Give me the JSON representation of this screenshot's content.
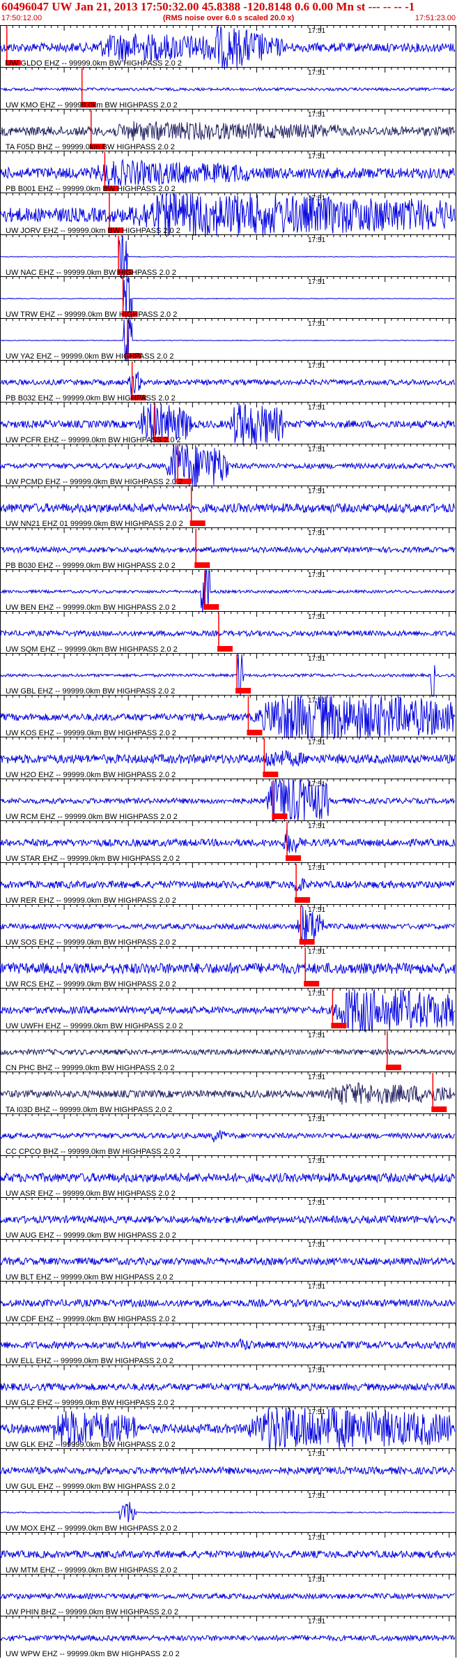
{
  "header": {
    "title": "60496047 UW Jan 21, 2013 17:50:32.00   45.8388 -120.8148  0.6 0.00 Mn st --- -- --  -1",
    "rms_note": "(RMS noise over 6.0 s scaled 20.0 x)",
    "time_start": "17:50:12.00",
    "time_end": "17:51:23.00"
  },
  "colors": {
    "trace": "#0000e0",
    "pick": "#ff0000",
    "axis": "#000000",
    "label": "#000000",
    "dark_trace": "#202060"
  },
  "minute_label": "17:51",
  "traces": [
    {
      "label": "UW GLDO EHZ -- 99999.0km BW  HIGHPASS  2.0  2",
      "amp": 0.25,
      "pick": 0.015,
      "bursts": [
        {
          "s": 0.18,
          "e": 0.62,
          "a": 0.9
        },
        {
          "s": 0.45,
          "e": 0.58,
          "a": 1.4
        }
      ]
    },
    {
      "label": "UW KMO EHZ -- 99999.0km BW  HIGHPASS  2.0  2",
      "amp": 0.08,
      "pick": 0.18,
      "bursts": []
    },
    {
      "label": "TA F05D BHZ -- 99999.0km BW  HIGHPASS  2.0  2",
      "amp": 0.25,
      "pick": 0.2,
      "dark": true,
      "bursts": [
        {
          "s": 0.2,
          "e": 0.75,
          "a": 0.6
        }
      ]
    },
    {
      "label": "PB B001 EHZ -- 99999.0km BW  HIGHPASS  2.0  2",
      "amp": 0.3,
      "pick": 0.23,
      "bursts": [
        {
          "s": 0.18,
          "e": 0.55,
          "a": 0.8
        }
      ]
    },
    {
      "label": "UW JORV EHZ -- 99999.0km BW  HIGHPASS  2.0  2",
      "amp": 0.4,
      "pick": 0.24,
      "bursts": [
        {
          "s": 0.24,
          "e": 0.99,
          "a": 1.4
        }
      ]
    },
    {
      "label": "UW NAC EHZ -- 99999.0km BW  HIGHPASS  2.0  2",
      "amp": 0.02,
      "pick": 0.26,
      "bursts": [
        {
          "s": 0.26,
          "e": 0.28,
          "a": 3.0
        }
      ]
    },
    {
      "label": "UW TRW EHZ -- 99999.0km BW  HIGHPASS  2.0  2",
      "amp": 0.02,
      "pick": 0.27,
      "bursts": [
        {
          "s": 0.27,
          "e": 0.29,
          "a": 3.0
        }
      ]
    },
    {
      "label": "UW YA2 EHZ -- 99999.0km BW  HIGHPASS  2.0  2",
      "amp": 0.02,
      "pick": 0.28,
      "bursts": [
        {
          "s": 0.27,
          "e": 0.29,
          "a": 3.0
        }
      ]
    },
    {
      "label": "PB B032 EHZ -- 99999.0km BW  HIGHPASS  2.0  2",
      "amp": 0.15,
      "pick": 0.29,
      "bursts": [
        {
          "s": 0.28,
          "e": 0.31,
          "a": 0.8
        }
      ]
    },
    {
      "label": "UW PCFR EHZ -- 99999.0km BW  HIGHPASS  2.0  2",
      "amp": 0.2,
      "pick": 0.34,
      "bursts": [
        {
          "s": 0.3,
          "e": 0.42,
          "a": 1.4
        },
        {
          "s": 0.5,
          "e": 0.62,
          "a": 1.5
        }
      ]
    },
    {
      "label": "UW PCMD EHZ -- 99999.0km BW  HIGHPASS  2.0  2",
      "amp": 0.15,
      "pick": 0.39,
      "bursts": [
        {
          "s": 0.36,
          "e": 0.5,
          "a": 1.6
        }
      ]
    },
    {
      "label": "UW NN21 EHZ 01 99999.0km BW  HIGHPASS  2.0  2",
      "amp": 0.25,
      "pick": 0.42,
      "bursts": []
    },
    {
      "label": "PB B030 EHZ -- 99999.0km BW  HIGHPASS  2.0  2",
      "amp": 0.15,
      "pick": 0.43,
      "bursts": []
    },
    {
      "label": "UW BEN EHZ -- 99999.0km BW  HIGHPASS  2.0  2",
      "amp": 0.08,
      "pick": 0.45,
      "bursts": [
        {
          "s": 0.44,
          "e": 0.46,
          "a": 2.6
        }
      ]
    },
    {
      "label": "UW SQM EHZ -- 99999.0km BW  HIGHPASS  2.0  2",
      "amp": 0.15,
      "pick": 0.48,
      "bursts": []
    },
    {
      "label": "UW GBL EHZ -- 99999.0km BW  HIGHPASS  2.0  2",
      "amp": 0.08,
      "pick": 0.52,
      "bursts": [
        {
          "s": 0.52,
          "e": 0.535,
          "a": 2.6
        },
        {
          "s": 0.945,
          "e": 0.955,
          "a": 2.6
        }
      ]
    },
    {
      "label": "UW KOS EHZ -- 99999.0km BW  HIGHPASS  2.0  2",
      "amp": 0.2,
      "pick": 0.545,
      "bursts": [
        {
          "s": 0.545,
          "e": 0.995,
          "a": 1.6
        }
      ]
    },
    {
      "label": "UW H2O EHZ -- 99999.0km BW  HIGHPASS  2.0  2",
      "amp": 0.25,
      "pick": 0.58,
      "bursts": [
        {
          "s": 0.57,
          "e": 0.67,
          "a": 0.6
        }
      ]
    },
    {
      "label": "UW RCM EHZ -- 99999.0km BW  HIGHPASS  2.0  2",
      "amp": 0.15,
      "pick": 0.6,
      "bursts": [
        {
          "s": 0.58,
          "e": 0.72,
          "a": 1.6
        }
      ]
    },
    {
      "label": "UW STAR EHZ -- 99999.0km BW  HIGHPASS  2.0  2",
      "amp": 0.2,
      "pick": 0.63,
      "bursts": [
        {
          "s": 0.62,
          "e": 0.66,
          "a": 0.8
        }
      ]
    },
    {
      "label": "UW RER EHZ -- 99999.0km BW  HIGHPASS  2.0  2",
      "amp": 0.2,
      "pick": 0.65,
      "bursts": [
        {
          "s": 0.64,
          "e": 0.67,
          "a": 0.6
        }
      ]
    },
    {
      "label": "UW SOS EHZ -- 99999.0km BW  HIGHPASS  2.0  2",
      "amp": 0.15,
      "pick": 0.66,
      "bursts": [
        {
          "s": 0.65,
          "e": 0.71,
          "a": 1.3
        }
      ]
    },
    {
      "label": "UW RCS EHZ -- 99999.0km BW  HIGHPASS  2.0  2",
      "amp": 0.3,
      "pick": 0.67,
      "bursts": []
    },
    {
      "label": "UW UWFH EHZ -- 99999.0km BW  HIGHPASS  2.0  2",
      "amp": 0.2,
      "pick": 0.73,
      "bursts": [
        {
          "s": 0.72,
          "e": 0.995,
          "a": 1.5
        }
      ]
    },
    {
      "label": "CN PHC BHZ -- 99999.0km BW  HIGHPASS  2.0  2",
      "amp": 0.15,
      "pick": 0.85,
      "dark": true,
      "bursts": []
    },
    {
      "label": "TA I03D BHZ -- 99999.0km BW  HIGHPASS  2.0  2",
      "amp": 0.2,
      "pick": 0.95,
      "dark": true,
      "bursts": [
        {
          "s": 0.7,
          "e": 0.99,
          "a": 0.7
        }
      ]
    },
    {
      "label": "CC CPCO BHZ -- 99999.0km BW  HIGHPASS  2.0  2",
      "amp": 0.15,
      "bursts": [
        {
          "s": 0.46,
          "e": 0.5,
          "a": 0.4
        }
      ]
    },
    {
      "label": "UW ASR EHZ -- 99999.0km BW  HIGHPASS  2.0  2",
      "amp": 0.25,
      "bursts": []
    },
    {
      "label": "UW AUG EHZ -- 99999.0km BW  HIGHPASS  2.0  2",
      "amp": 0.2,
      "bursts": []
    },
    {
      "label": "UW BLT EHZ -- 99999.0km BW  HIGHPASS  2.0  2",
      "amp": 0.2,
      "bursts": []
    },
    {
      "label": "UW CDF EHZ -- 99999.0km BW  HIGHPASS  2.0  2",
      "amp": 0.2,
      "bursts": []
    },
    {
      "label": "UW ELL EHZ -- 99999.0km BW  HIGHPASS  2.0  2",
      "amp": 0.2,
      "bursts": [
        {
          "s": 0.52,
          "e": 0.56,
          "a": 0.4
        }
      ]
    },
    {
      "label": "UW GL2 EHZ -- 99999.0km BW  HIGHPASS  2.0  2",
      "amp": 0.2,
      "bursts": []
    },
    {
      "label": "UW GLK EHZ -- 99999.0km BW  HIGHPASS  2.0  2",
      "amp": 0.25,
      "bursts": [
        {
          "s": 0.1,
          "e": 0.3,
          "a": 1.2
        },
        {
          "s": 0.52,
          "e": 0.99,
          "a": 1.4
        }
      ]
    },
    {
      "label": "UW GUL EHZ -- 99999.0km BW  HIGHPASS  2.0  2",
      "amp": 0.2,
      "bursts": []
    },
    {
      "label": "UW MOX EHZ -- 99999.0km BW  HIGHPASS  2.0  2",
      "amp": 0.03,
      "bursts": [
        {
          "s": 0.26,
          "e": 0.3,
          "a": 0.9
        }
      ]
    },
    {
      "label": "UW MTM EHZ -- 99999.0km BW  HIGHPASS  2.0  2",
      "amp": 0.2,
      "bursts": []
    },
    {
      "label": "UW PHIN BHZ -- 99999.0km BW  HIGHPASS  2.0  2",
      "amp": 0.15,
      "bursts": []
    },
    {
      "label": "UW WPW EHZ -- 99999.0km BW  HIGHPASS  2.0  2",
      "amp": 0.15,
      "bursts": []
    }
  ]
}
